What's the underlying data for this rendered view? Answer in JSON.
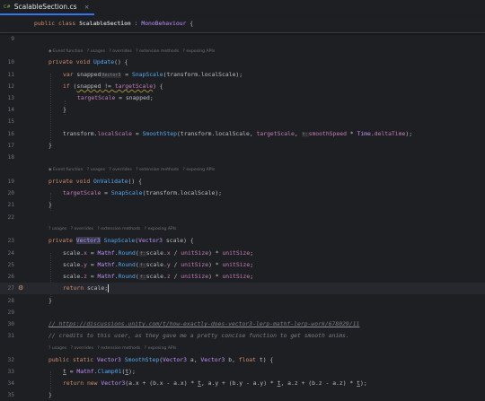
{
  "tab": {
    "icon": "C#",
    "title": "ScalableSection.cs",
    "close": "×"
  },
  "sticky_header": {
    "kw1": "public",
    "kw2": "class",
    "name": "ScalableSection",
    "sep": ":",
    "base": "MonoBehaviour",
    "brace": "{"
  },
  "lines": [
    {
      "n": "9"
    },
    {
      "n": "10"
    },
    {
      "n": "11"
    },
    {
      "n": "12"
    },
    {
      "n": "13"
    },
    {
      "n": "14"
    },
    {
      "n": "15"
    },
    {
      "n": "16"
    },
    {
      "n": "17"
    },
    {
      "n": "18"
    },
    {
      "n": "19"
    },
    {
      "n": "20"
    },
    {
      "n": "21"
    },
    {
      "n": "22"
    },
    {
      "n": "23"
    },
    {
      "n": "24"
    },
    {
      "n": "25"
    },
    {
      "n": "26"
    },
    {
      "n": "27"
    },
    {
      "n": "28"
    },
    {
      "n": "29"
    },
    {
      "n": "30"
    },
    {
      "n": "31"
    },
    {
      "n": "32"
    },
    {
      "n": "33"
    },
    {
      "n": "34"
    },
    {
      "n": "35"
    }
  ],
  "lens": {
    "event": "Event function",
    "usages": "usages",
    "overrides": "overrides",
    "ext": "extension methods",
    "apis": "exposing APIs",
    "q": "?"
  },
  "code": {
    "private": "private",
    "void": "void",
    "var": "var",
    "if": "if",
    "return": "return",
    "public": "public",
    "static": "static",
    "float": "float",
    "update": "Update",
    "onvalidate": "OnValidate",
    "snapscale": "SnapScale",
    "smoothstep": "SmoothStep",
    "snapped": "snapped",
    "vector3": "Vector3",
    "transform_localScale": "transform.localScale",
    "targetScale": "targetScale",
    "transform": "transform",
    "localScale": "localScale",
    "smoothSpeed": "smoothSpeed",
    "time": "Time",
    "deltaTime": "deltaTime",
    "scale": "scale",
    "mathf": "Mathf",
    "round": "Round",
    "unitSize": "unitSize",
    "clamp01": "Clamp01",
    "hint_f": "f:",
    "hint_t": "t:",
    "comment1": "// https://discussions.unity.com/t/how-exactly-does-vector3-lerp-mathf-lerp-work/678029/11",
    "comment2": "// credits to this user, as they gave me a pretty concise function to get smooth anims.",
    "a": "a",
    "b": "b",
    "t": "t",
    "x": "x",
    "y": "y",
    "z": "z"
  }
}
